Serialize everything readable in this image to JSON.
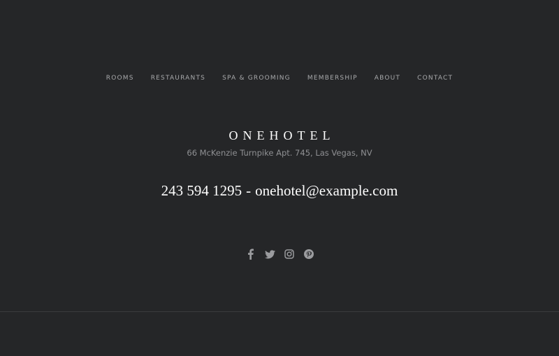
{
  "nav": {
    "items": [
      {
        "label": "ROOMS"
      },
      {
        "label": "RESTAURANTS"
      },
      {
        "label": "SPA & GROOMING"
      },
      {
        "label": "MEMBERSHIP"
      },
      {
        "label": "ABOUT"
      },
      {
        "label": "CONTACT"
      }
    ]
  },
  "brand": {
    "name": "ONEHOTEL"
  },
  "contact": {
    "address": "66 McKenzie Turnpike Apt. 745, Las Vegas, NV",
    "phone": "243 594 1295",
    "separator": "-",
    "email": "onehotel@example.com"
  },
  "social": {
    "icons": [
      "facebook-icon",
      "twitter-icon",
      "instagram-icon",
      "pinterest-icon"
    ],
    "icon_color": "#9a9b9e"
  },
  "colors": {
    "background": "#252628",
    "text_primary": "#ffffff",
    "text_muted": "#8f9093",
    "divider": "#3a3b3e"
  }
}
